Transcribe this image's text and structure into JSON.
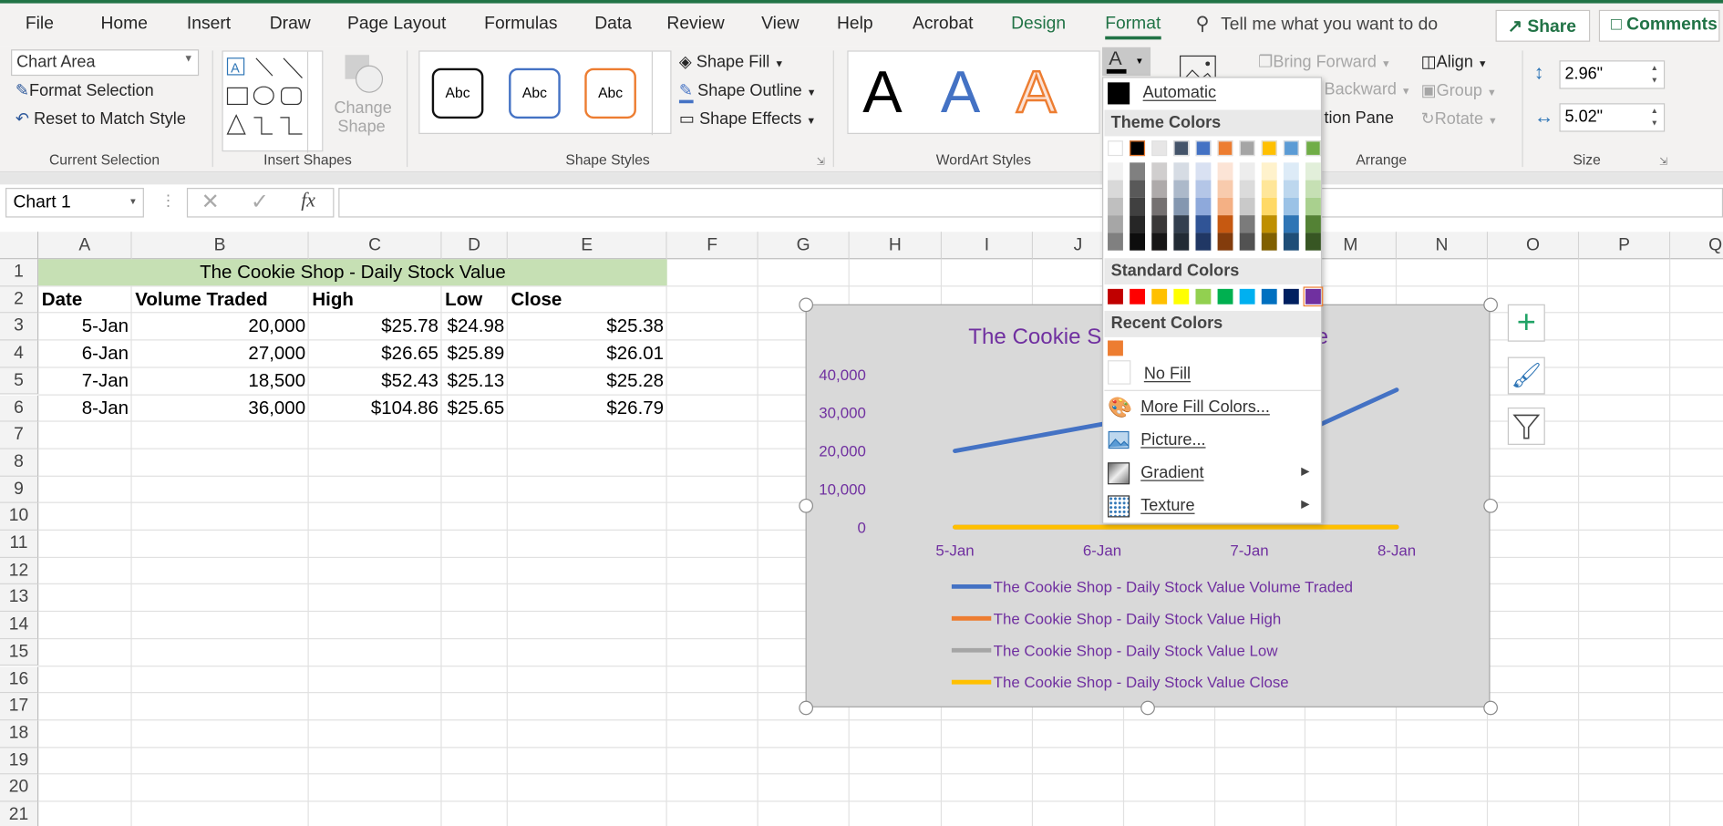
{
  "tabs": [
    {
      "label": "File"
    },
    {
      "label": "Home"
    },
    {
      "label": "Insert"
    },
    {
      "label": "Draw"
    },
    {
      "label": "Page Layout"
    },
    {
      "label": "Formulas"
    },
    {
      "label": "Data"
    },
    {
      "label": "Review"
    },
    {
      "label": "View"
    },
    {
      "label": "Help"
    },
    {
      "label": "Acrobat"
    },
    {
      "label": "Design"
    },
    {
      "label": "Format"
    }
  ],
  "active_tab": "Format",
  "search": {
    "placeholder": "Tell me what you want to do"
  },
  "share_label": "Share",
  "comments_label": "Comments",
  "ribbon": {
    "current_selection": {
      "dropdown_value": "Chart Area",
      "format_selection": "Format Selection",
      "reset": "Reset to Match Style",
      "label": "Current Selection"
    },
    "insert_shapes": {
      "change_shape_1": "Change",
      "change_shape_2": "Shape",
      "label": "Insert Shapes"
    },
    "shape_styles": {
      "preset": "Abc",
      "shape_fill": "Shape Fill",
      "shape_outline": "Shape Outline",
      "shape_effects": "Shape Effects",
      "label": "Shape Styles"
    },
    "wordart": {
      "letter": "A",
      "label": "WordArt Styles"
    },
    "arrange": {
      "bring_forward": "Bring Forward",
      "send_backward": "Backward",
      "selection_pane": "tion Pane",
      "align": "Align",
      "group": "Group",
      "rotate": "Rotate",
      "label": "Arrange"
    },
    "size": {
      "height": "2.96\"",
      "width": "5.02\"",
      "label": "Size"
    }
  },
  "formula_bar": {
    "name_box": "Chart 1",
    "fx": "fx",
    "value": ""
  },
  "columns": [
    "A",
    "B",
    "C",
    "D",
    "E",
    "F",
    "G",
    "H",
    "I",
    "J",
    "K",
    "L",
    "M",
    "N",
    "O",
    "P",
    "Q"
  ],
  "rows": [
    1,
    2,
    3,
    4,
    5,
    6,
    7,
    8,
    9,
    10,
    11,
    12,
    13,
    14,
    15,
    16,
    17,
    18,
    19,
    20,
    21
  ],
  "sheet": {
    "title": "The Cookie Shop - Daily Stock Value",
    "headers": [
      "Date",
      "Volume Traded",
      "High",
      "Low",
      "Close"
    ],
    "data": [
      [
        "5-Jan",
        "20,000",
        "$25.78",
        "$24.98",
        "$25.38"
      ],
      [
        "6-Jan",
        "27,000",
        "$26.65",
        "$25.89",
        "$26.01"
      ],
      [
        "7-Jan",
        "18,500",
        "$52.43",
        "$25.13",
        "$25.28"
      ],
      [
        "8-Jan",
        "36,000",
        "$104.86",
        "$25.65",
        "$26.79"
      ]
    ]
  },
  "chart_data": {
    "type": "line",
    "title": "The Cookie Shop - Daily Stock Value",
    "categories": [
      "5-Jan",
      "6-Jan",
      "7-Jan",
      "8-Jan"
    ],
    "yticks": [
      "0",
      "10,000",
      "20,000",
      "30,000",
      "40,000"
    ],
    "ylim": [
      0,
      40000
    ],
    "legend_position": "bottom",
    "text_color": "#7030A0",
    "background": "#D9D9D9",
    "series": [
      {
        "name": "The Cookie Shop - Daily Stock Value Volume Traded",
        "values": [
          20000,
          27000,
          18500,
          36000
        ],
        "color": "#4472C4"
      },
      {
        "name": "The Cookie Shop - Daily Stock Value High",
        "values": [
          25.78,
          26.65,
          52.43,
          104.86
        ],
        "color": "#ED7D31"
      },
      {
        "name": "The Cookie Shop - Daily Stock Value Low",
        "values": [
          24.98,
          25.89,
          25.13,
          25.65
        ],
        "color": "#A5A5A5"
      },
      {
        "name": "The Cookie Shop - Daily Stock Value Close",
        "values": [
          25.38,
          26.01,
          25.28,
          26.79
        ],
        "color": "#FFC000"
      }
    ]
  },
  "color_menu": {
    "automatic": "Automatic",
    "theme_header": "Theme Colors",
    "theme_colors": [
      "#FFFFFF",
      "#000000",
      "#E7E6E6",
      "#44546A",
      "#4472C4",
      "#ED7D31",
      "#A5A5A5",
      "#FFC000",
      "#5B9BD5",
      "#70AD47"
    ],
    "theme_shades": [
      [
        "#F2F2F2",
        "#D9D9D9",
        "#BFBFBF",
        "#A6A6A6",
        "#808080"
      ],
      [
        "#808080",
        "#595959",
        "#404040",
        "#262626",
        "#0D0D0D"
      ],
      [
        "#D0CECE",
        "#AEAAAA",
        "#757171",
        "#3A3838",
        "#171616"
      ],
      [
        "#D6DCE4",
        "#ACB9CA",
        "#8497B0",
        "#333F4F",
        "#222B35"
      ],
      [
        "#D9E1F2",
        "#B4C6E7",
        "#8EA9DB",
        "#305496",
        "#203764"
      ],
      [
        "#FCE4D6",
        "#F8CBAD",
        "#F4B084",
        "#C65911",
        "#833C0C"
      ],
      [
        "#EDEDED",
        "#DBDBDB",
        "#C9C9C9",
        "#7B7B7B",
        "#525252"
      ],
      [
        "#FFF2CC",
        "#FFE699",
        "#FFD966",
        "#BF8F00",
        "#806000"
      ],
      [
        "#DDEBF7",
        "#BDD7EE",
        "#9BC2E6",
        "#2F75B5",
        "#1F4E78"
      ],
      [
        "#E2EFDA",
        "#C6E0B4",
        "#A9D08E",
        "#548235",
        "#375623"
      ]
    ],
    "standard_header": "Standard Colors",
    "standard_colors": [
      "#C00000",
      "#FF0000",
      "#FFC000",
      "#FFFF00",
      "#92D050",
      "#00B050",
      "#00B0F0",
      "#0070C0",
      "#002060",
      "#7030A0"
    ],
    "recent_header": "Recent Colors",
    "recent_colors": [
      "#ED7D31"
    ],
    "no_fill": "No Fill",
    "more_colors": "More Fill Colors...",
    "picture": "Picture...",
    "gradient": "Gradient",
    "texture": "Texture"
  }
}
